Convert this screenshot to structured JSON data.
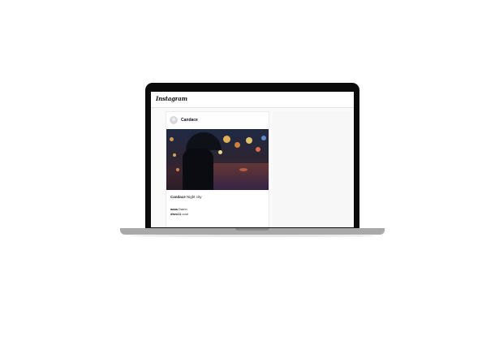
{
  "app": {
    "logo_text": "Instagram"
  },
  "post": {
    "username": "Candace",
    "caption_user": "Candace",
    "caption_text": "Night city",
    "comments": [
      {
        "user": "aaaa",
        "text": "Damn"
      },
      {
        "user": "dlwo11",
        "text": "cool"
      }
    ]
  },
  "colors": {
    "laptop_bezel": "#0b0b0b",
    "laptop_base": "#a9a9a9",
    "screen_bg": "#fafafa"
  }
}
